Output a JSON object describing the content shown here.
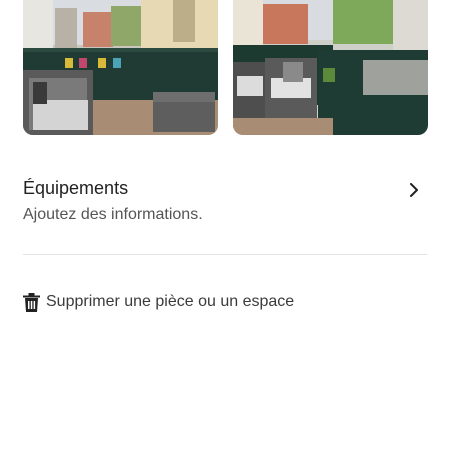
{
  "photos": [
    {
      "alt_icon": "terrace-photo-1"
    },
    {
      "alt_icon": "terrace-photo-2"
    }
  ],
  "amenities": {
    "title": "Équipements",
    "subtitle": "Ajoutez des informations."
  },
  "delete_action": {
    "label": "Supprimer une pièce ou un espace",
    "icon": "trash-icon"
  },
  "colors": {
    "text": "#222222",
    "subtext": "#555555",
    "divider": "#e2e2e2"
  }
}
